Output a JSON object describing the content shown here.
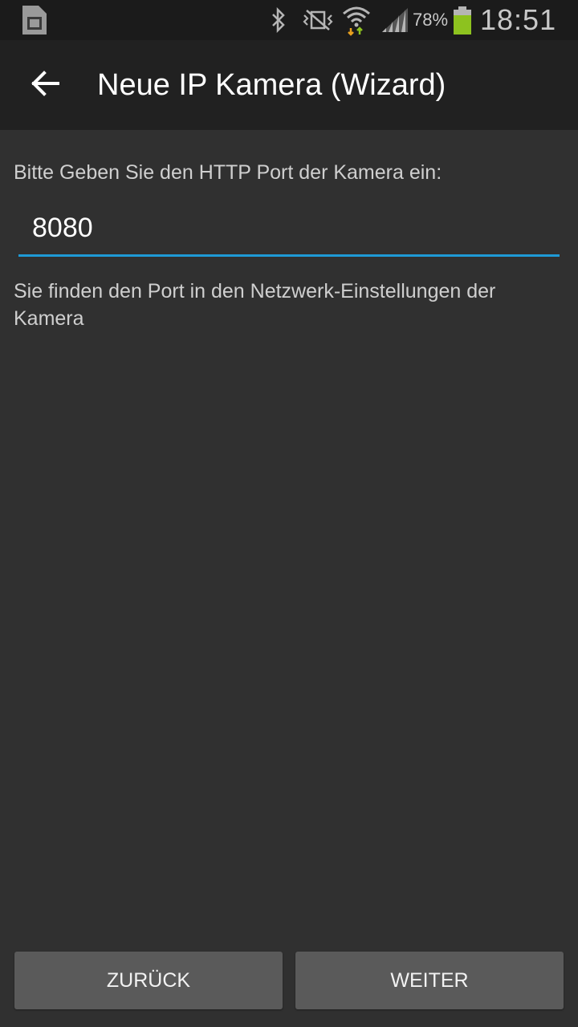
{
  "status_bar": {
    "battery_percent": "78%",
    "time": "18:51",
    "icons": [
      "sim-card-icon",
      "bluetooth-icon",
      "vibrate-icon",
      "wifi-icon",
      "signal-icon",
      "battery-icon"
    ],
    "battery_color": "#8dc21f"
  },
  "app_bar": {
    "title": "Neue IP Kamera (Wizard)",
    "back_icon": "arrow-back-icon"
  },
  "form": {
    "prompt": "Bitte Geben Sie den HTTP Port der Kamera ein:",
    "port_value": "8080",
    "hint": "Sie finden den Port in den Netzwerk-Einstellungen der Kamera",
    "accent_color": "#1e9ad6"
  },
  "buttons": {
    "back_label": "ZURÜCK",
    "next_label": "WEITER"
  }
}
